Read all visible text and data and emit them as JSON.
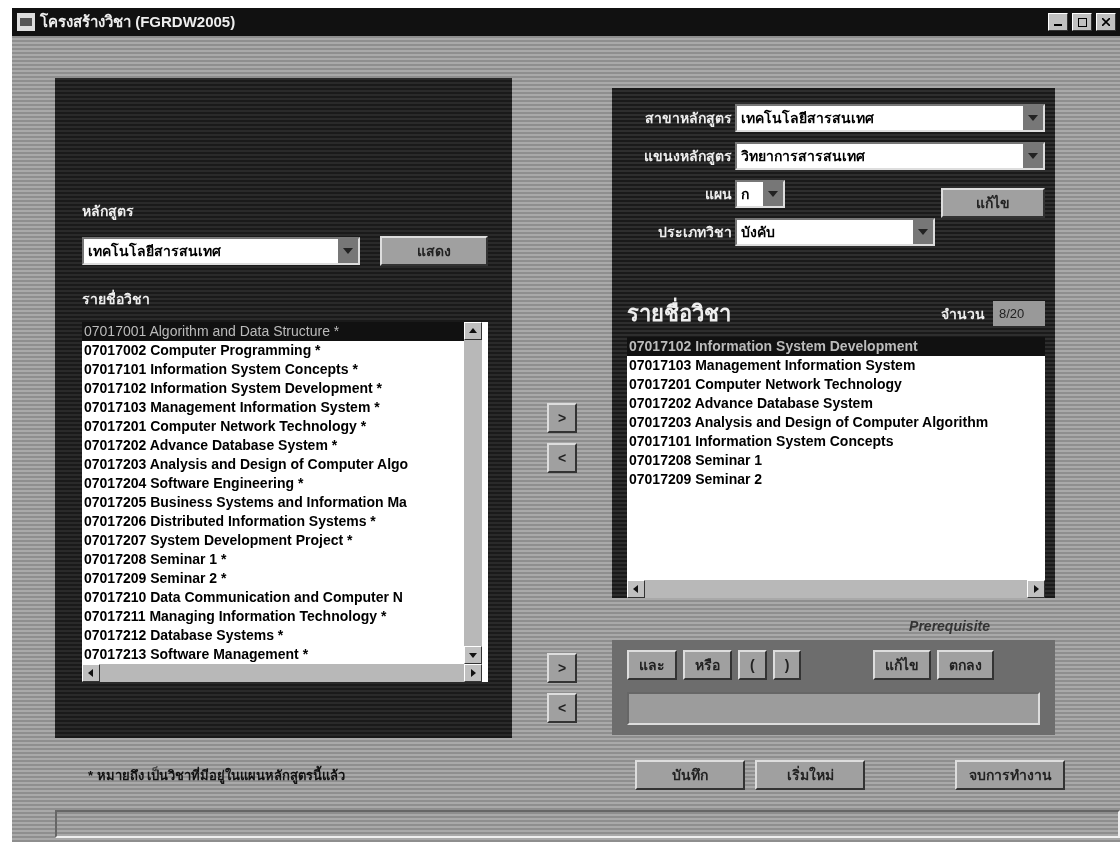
{
  "window": {
    "title": "โครงสร้างวิชา (FGRDW2005)"
  },
  "left_panel": {
    "curriculum_label": "หลักสูตร",
    "curriculum_value": "เทคโนโลยีสารสนเทศ",
    "show_button": "แสดง",
    "list_label": "รายชื่อวิชา",
    "courses": [
      {
        "text": "07017001 Algorithm and Data Structure *",
        "selected": true
      },
      {
        "text": "07017002 Computer Programming *",
        "selected": false
      },
      {
        "text": "07017101 Information System Concepts *",
        "selected": false
      },
      {
        "text": "07017102 Information System Development *",
        "selected": false
      },
      {
        "text": "07017103 Management Information System *",
        "selected": false
      },
      {
        "text": "07017201 Computer Network Technology *",
        "selected": false
      },
      {
        "text": "07017202 Advance Database System *",
        "selected": false
      },
      {
        "text": "07017203 Analysis and Design of Computer Algo",
        "selected": false
      },
      {
        "text": "07017204 Software Engineering *",
        "selected": false
      },
      {
        "text": "07017205 Business Systems and Information Ma",
        "selected": false
      },
      {
        "text": "07017206 Distributed Information Systems *",
        "selected": false
      },
      {
        "text": "07017207 System Development Project *",
        "selected": false
      },
      {
        "text": "07017208 Seminar 1 *",
        "selected": false
      },
      {
        "text": "07017209 Seminar 2 *",
        "selected": false
      },
      {
        "text": "07017210 Data Communication and Computer N",
        "selected": false
      },
      {
        "text": "07017211 Managing Information Technology *",
        "selected": false
      },
      {
        "text": "07017212 Database Systems *",
        "selected": false
      },
      {
        "text": "07017213 Software Management *",
        "selected": false
      }
    ]
  },
  "transfer_buttons": [
    ">",
    "<"
  ],
  "right_panel": {
    "fields": [
      {
        "label": "สาขาหลักสูตร",
        "value": "เทคโนโลยีสารสนเทศ",
        "kind": "wide"
      },
      {
        "label": "แขนงหลักสูตร",
        "value": "วิทยาการสารสนเทศ",
        "kind": "wide"
      },
      {
        "label": "แผน",
        "value": "ก",
        "kind": "short"
      },
      {
        "label": "ประเภทวิชา",
        "value": "บังคับ",
        "kind": "medium"
      }
    ],
    "edit_button": "แก้ไข",
    "list_label": "รายชื่อวิชา",
    "count_label": "จำนวน",
    "count": "8/20",
    "courses": [
      {
        "text": "07017102 Information System Development",
        "selected": true
      },
      {
        "text": "07017103 Management Information System",
        "selected": false
      },
      {
        "text": "07017201 Computer Network Technology",
        "selected": false
      },
      {
        "text": "07017202 Advance Database System",
        "selected": false
      },
      {
        "text": "07017203 Analysis and Design of Computer Algorithm",
        "selected": false
      },
      {
        "text": "07017101 Information System Concepts",
        "selected": false
      },
      {
        "text": "07017208 Seminar 1",
        "selected": false
      },
      {
        "text": "07017209 Seminar 2",
        "selected": false
      }
    ]
  },
  "prerequisite_transfer_buttons": [
    ">",
    "<"
  ],
  "prerequisite": {
    "title": "Prerequisite",
    "operator_buttons": [
      "และ",
      "หรือ",
      "(",
      ")"
    ],
    "action_buttons": [
      "แก้ไข",
      "ตกลง"
    ]
  },
  "footnote": "* หมายถึง เป็นวิชาที่มีอยู่ในแผนหลักสูตรนี้แล้ว",
  "buttons": [
    "บันทึก",
    "เริ่มใหม่",
    "จบการทำงาน"
  ]
}
